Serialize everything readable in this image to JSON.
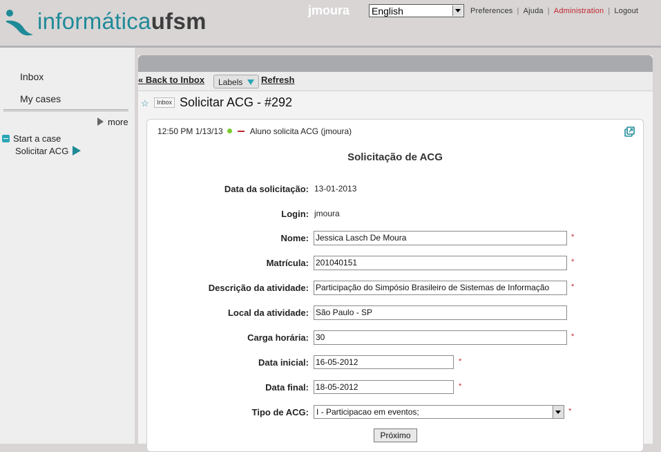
{
  "header": {
    "logo_part1": "informática",
    "logo_part2": "ufsm",
    "username": "jmoura",
    "language": "English",
    "links": {
      "preferences": "Preferences",
      "help": "Ajuda",
      "administration": "Administration",
      "logout": "Logout"
    },
    "separator": "|",
    "accent_color": "#1f8a97",
    "admin_color": "#c0262d"
  },
  "sidebar": {
    "inbox": "Inbox",
    "my_cases": "My cases",
    "more": "more",
    "start_case": "Start a case",
    "process": "Solicitar ACG"
  },
  "toolbar": {
    "back": "« Back to Inbox",
    "labels": "Labels",
    "refresh": "Refresh"
  },
  "case": {
    "tag": "Inbox",
    "title": "Solicitar ACG - #292",
    "meta_time": "12:50 PM 1/13/13",
    "meta_step": "Aluno solicita ACG (jmoura)"
  },
  "form": {
    "title": "Solicitação de ACG",
    "required_mark": "*",
    "fields": {
      "data_solicitacao": {
        "label": "Data da solicitação:",
        "value": "13-01-2013"
      },
      "login": {
        "label": "Login:",
        "value": "jmoura"
      },
      "nome": {
        "label": "Nome:",
        "value": "Jessica Lasch De Moura"
      },
      "matricula": {
        "label": "Matrícula:",
        "value": "201040151"
      },
      "descricao": {
        "label": "Descrição da atividade:",
        "value": "Participação do Simpósio Brasileiro de Sistemas de Informação"
      },
      "local": {
        "label": "Local da atividade:",
        "value": "São Paulo - SP"
      },
      "carga": {
        "label": "Carga horária:",
        "value": "30"
      },
      "data_inicial": {
        "label": "Data inicial:",
        "value": "16-05-2012"
      },
      "data_final": {
        "label": "Data final:",
        "value": "18-05-2012"
      },
      "tipo": {
        "label": "Tipo de ACG:",
        "value": "I - Participacao em eventos;"
      }
    },
    "submit": "Próximo"
  }
}
